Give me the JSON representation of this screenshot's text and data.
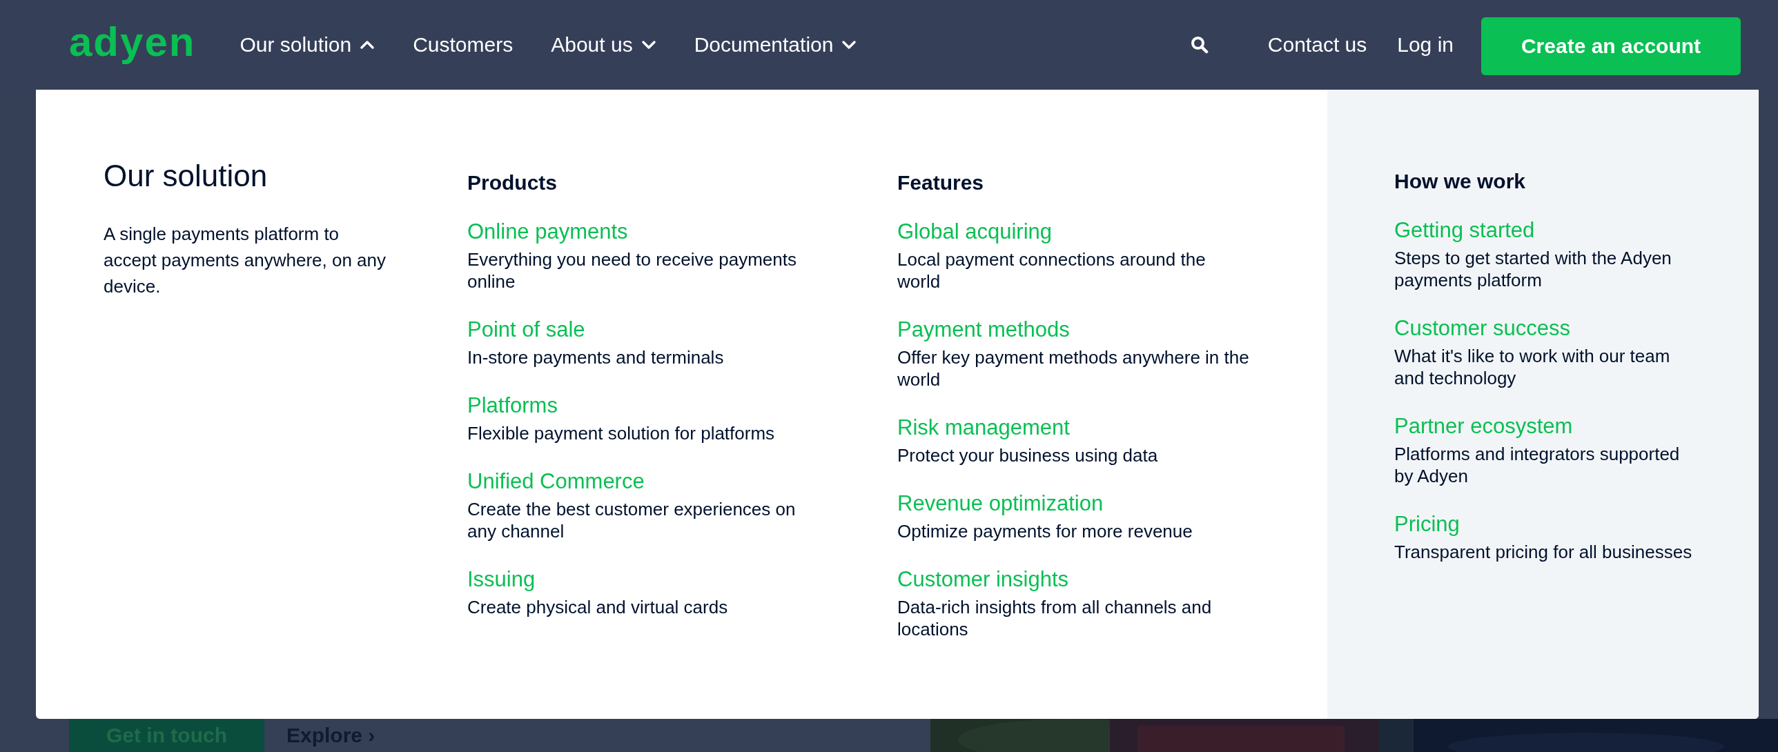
{
  "nav": {
    "logo": "adyen",
    "items": [
      {
        "label": "Our solution",
        "kind": "dropdown",
        "expanded": true
      },
      {
        "label": "Customers",
        "kind": "link"
      },
      {
        "label": "About us",
        "kind": "dropdown",
        "expanded": false
      },
      {
        "label": "Documentation",
        "kind": "dropdown",
        "expanded": false
      }
    ],
    "links": [
      "Contact us",
      "Log in"
    ],
    "cta": "Create an account"
  },
  "menu": {
    "intro": {
      "title": "Our solution",
      "text": "A single payments platform to accept payments anywhere, on any device."
    },
    "columns": [
      {
        "heading": "Products",
        "items": [
          {
            "title": "Online payments",
            "text": "Everything you need to receive payments online"
          },
          {
            "title": "Point of sale",
            "text": "In-store payments and terminals"
          },
          {
            "title": "Platforms",
            "text": "Flexible payment solution for platforms"
          },
          {
            "title": "Unified Commerce",
            "text": "Create the best customer experiences on any channel"
          },
          {
            "title": "Issuing",
            "text": "Create physical and virtual cards"
          }
        ]
      },
      {
        "heading": "Features",
        "items": [
          {
            "title": "Global acquiring",
            "text": "Local payment connections around the world"
          },
          {
            "title": "Payment methods",
            "text": "Offer key payment methods anywhere in the world"
          },
          {
            "title": "Risk management",
            "text": "Protect your business using data"
          },
          {
            "title": "Revenue optimization",
            "text": "Optimize payments for more revenue"
          },
          {
            "title": "Customer insights",
            "text": "Data-rich insights from all channels and locations"
          }
        ]
      }
    ],
    "side": {
      "heading": "How we work",
      "items": [
        {
          "title": "Getting started",
          "text": "Steps to get started with the Adyen payments platform"
        },
        {
          "title": "Customer success",
          "text": "What it's like to work with our team and technology"
        },
        {
          "title": "Partner ecosystem",
          "text": "Platforms and integrators supported by Adyen"
        },
        {
          "title": "Pricing",
          "text": "Transparent pricing for all businesses"
        }
      ]
    }
  },
  "behind": {
    "button": "Get in touch",
    "link": "Explore ›"
  }
}
